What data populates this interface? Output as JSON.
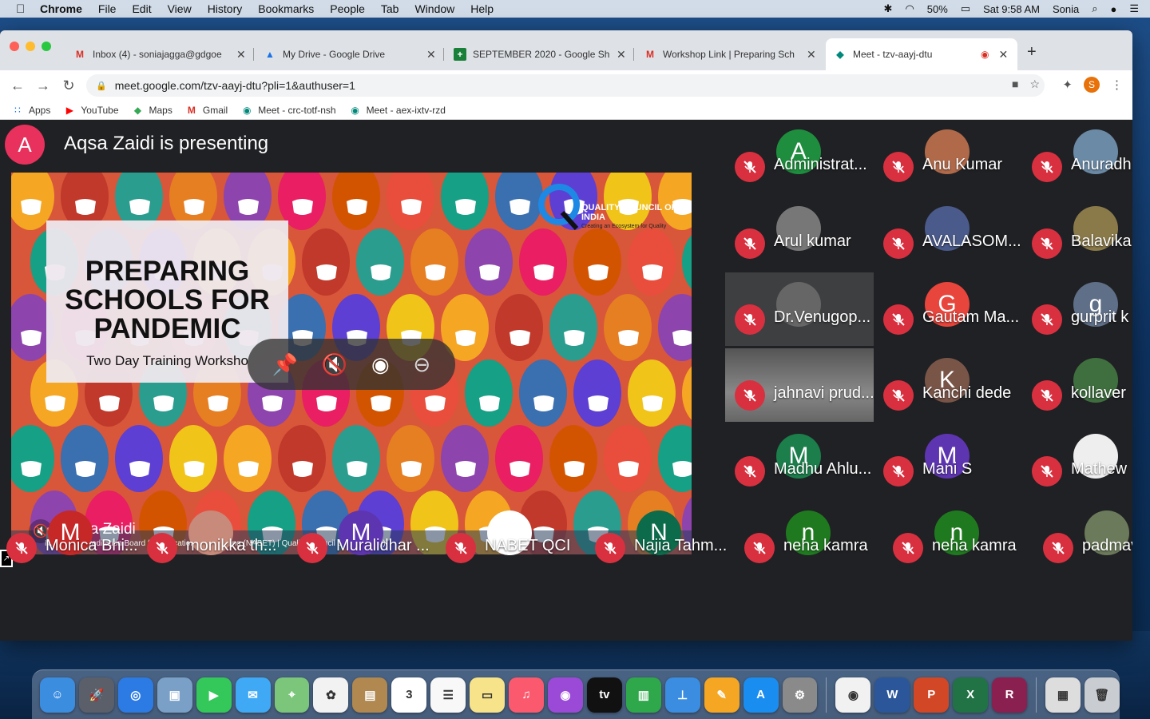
{
  "menubar": {
    "app": "Chrome",
    "items": [
      "File",
      "Edit",
      "View",
      "History",
      "Bookmarks",
      "People",
      "Tab",
      "Window",
      "Help"
    ],
    "battery": "50%",
    "clock": "Sat 9:58 AM",
    "user": "Sonia"
  },
  "tabs": [
    {
      "title": "Inbox (4) - soniajagga@gdgoe",
      "icon": "gmail-icon",
      "active": false
    },
    {
      "title": "My Drive - Google Drive",
      "icon": "google-drive-icon",
      "active": false
    },
    {
      "title": "SEPTEMBER 2020 - Google Sh",
      "icon": "google-sheets-icon",
      "active": false
    },
    {
      "title": "Workshop Link | Preparing Sch",
      "icon": "gmail-icon",
      "active": false
    },
    {
      "title": "Meet - tzv-aayj-dtu",
      "icon": "google-meet-icon",
      "active": true
    }
  ],
  "address": {
    "url": "meet.google.com/tzv-aayj-dtu?pli=1&authuser=1"
  },
  "profile_initial": "S",
  "bookmarks": [
    {
      "label": "Apps",
      "icon": "apps-grid-icon"
    },
    {
      "label": "YouTube",
      "icon": "youtube-icon"
    },
    {
      "label": "Maps",
      "icon": "maps-icon"
    },
    {
      "label": "Gmail",
      "icon": "gmail-icon"
    },
    {
      "label": "Meet - crc-totf-nsh",
      "icon": "google-meet-icon"
    },
    {
      "label": "Meet - aex-ixtv-rzd",
      "icon": "google-meet-icon"
    }
  ],
  "meet": {
    "presenter_initial": "A",
    "presenting_text": "Aqsa Zaidi is presenting",
    "slide": {
      "title": "PREPARING\nSCHOOLS FOR\nPANDEMIC",
      "subtitle": "Two Day Training Worksho",
      "org_name": "QUALITY COUNCIL OF INDIA",
      "org_tag": "Creating an Ecosystem for Quality",
      "footer": "National Accreditation Board for Education and Training  (NABET)  |  Quality Council of India (QCI)"
    },
    "presenter_name": "Aqsa Zaidi",
    "participants": [
      {
        "name": "Administrat...",
        "initial": "A",
        "color": "#1e8e3e"
      },
      {
        "name": "Anu Kumar",
        "initial": "",
        "color": "#b06a4a"
      },
      {
        "name": "Anuradh",
        "initial": "",
        "color": "#6b8aa6"
      },
      {
        "name": "Arul kumar",
        "initial": "",
        "color": "#777777"
      },
      {
        "name": "AVALASOM...",
        "initial": "",
        "color": "#4a5a8a"
      },
      {
        "name": "Balavika",
        "initial": "",
        "color": "#8a7a4a"
      },
      {
        "name": "Dr.Venugop...",
        "initial": "",
        "color": "#666666"
      },
      {
        "name": "Gautam Ma...",
        "initial": "G",
        "color": "#e8453c"
      },
      {
        "name": "gurprit k",
        "initial": "g",
        "color": "#5f6f87"
      },
      {
        "name": "jahnavi prud...",
        "initial": "",
        "color": "#555555"
      },
      {
        "name": "Kanchi dede",
        "initial": "K",
        "color": "#795548"
      },
      {
        "name": "kollaver",
        "initial": "",
        "color": "#3f6f3f"
      },
      {
        "name": "Madhu Ahlu...",
        "initial": "M",
        "color": "#1b7e4b"
      },
      {
        "name": "Mani S",
        "initial": "M",
        "color": "#5e35b1"
      },
      {
        "name": "Mathew",
        "initial": "",
        "color": "#eeeeee"
      },
      {
        "name": "Monica Bhi...",
        "initial": "M",
        "color": "#c62828"
      },
      {
        "name": "monikka th...",
        "initial": "",
        "color": "#c88a7a"
      },
      {
        "name": "Muralidhar ...",
        "initial": "M",
        "color": "#5e35b1"
      },
      {
        "name": "NABET QCI",
        "initial": "",
        "color": "#ffffff"
      },
      {
        "name": "Najia Tahm...",
        "initial": "N",
        "color": "#0b6b4b"
      },
      {
        "name": "neha kamra",
        "initial": "n",
        "color": "#1f7a1f"
      },
      {
        "name": "neha kamra",
        "initial": "n",
        "color": "#1f7a1f"
      },
      {
        "name": "padmav",
        "initial": "",
        "color": "#6b7a5a"
      }
    ]
  },
  "dock": [
    {
      "name": "finder-icon",
      "color": "#3b8de0",
      "glyph": "☺"
    },
    {
      "name": "launchpad-icon",
      "color": "#5a5f6a",
      "glyph": "🚀"
    },
    {
      "name": "safari-icon",
      "color": "#2c7be5",
      "glyph": "◎"
    },
    {
      "name": "preview-icon",
      "color": "#7aa0c8",
      "glyph": "▣"
    },
    {
      "name": "facetime-icon",
      "color": "#34c759",
      "glyph": "▶"
    },
    {
      "name": "messages-icon",
      "color": "#3fa9f5",
      "glyph": "✉"
    },
    {
      "name": "maps-app-icon",
      "color": "#7bc67b",
      "glyph": "⌖"
    },
    {
      "name": "photos-icon",
      "color": "#f2f2f2",
      "glyph": "✿"
    },
    {
      "name": "notebook-icon",
      "color": "#b08850",
      "glyph": "▤"
    },
    {
      "name": "calendar-icon",
      "color": "#ffffff",
      "glyph": "3"
    },
    {
      "name": "reminders-icon",
      "color": "#f8f8f8",
      "glyph": "☰"
    },
    {
      "name": "notes-icon",
      "color": "#f7e38a",
      "glyph": "▭"
    },
    {
      "name": "music-icon",
      "color": "#fb5a6e",
      "glyph": "♫"
    },
    {
      "name": "podcasts-icon",
      "color": "#9b4ad8",
      "glyph": "◉"
    },
    {
      "name": "apple-tv-icon",
      "color": "#111111",
      "glyph": "tv"
    },
    {
      "name": "numbers-icon",
      "color": "#2ea84a",
      "glyph": "▥"
    },
    {
      "name": "keynote-icon",
      "color": "#3a8de0",
      "glyph": "⊥"
    },
    {
      "name": "pages-icon",
      "color": "#f5a623",
      "glyph": "✎"
    },
    {
      "name": "app-store-icon",
      "color": "#1a8ef0",
      "glyph": "A"
    },
    {
      "name": "system-preferences-icon",
      "color": "#8a8a8a",
      "glyph": "⚙"
    },
    {
      "name": "chrome-icon",
      "color": "#f1f1f1",
      "glyph": "◉"
    },
    {
      "name": "word-icon",
      "color": "#2b579a",
      "glyph": "W"
    },
    {
      "name": "powerpoint-icon",
      "color": "#d24726",
      "glyph": "P"
    },
    {
      "name": "excel-icon",
      "color": "#217346",
      "glyph": "X"
    },
    {
      "name": "rar-icon",
      "color": "#8a2050",
      "glyph": "R"
    },
    {
      "name": "screen-capture-icon",
      "color": "#ddd",
      "glyph": "▦"
    },
    {
      "name": "trash-icon",
      "color": "#c9ccd1",
      "glyph": "🗑"
    }
  ]
}
